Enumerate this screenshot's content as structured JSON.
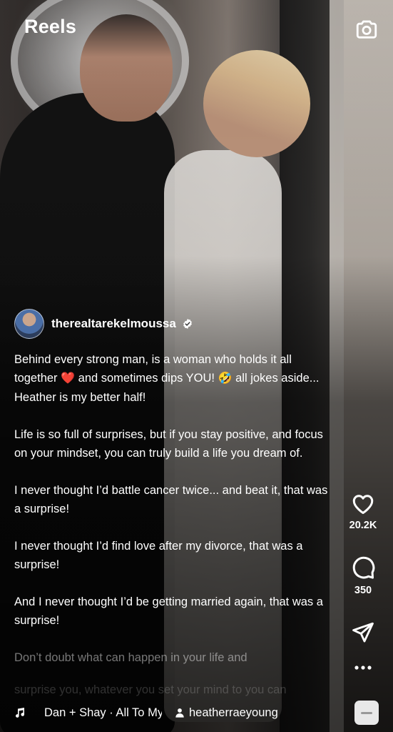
{
  "header": {
    "title": "Reels",
    "camera_icon": "camera-icon"
  },
  "post": {
    "username": "therealtarekelmoussa",
    "verified_icon": "verified-badge-icon",
    "caption": [
      {
        "before": "Behind every strong man, is a woman who holds it all together ",
        "emoji1": "❤️",
        "middle": " and sometimes dips YOU! ",
        "emoji2": "🤣",
        "after": "  all jokes aside... Heather is my better half!"
      },
      "Life is so full of surprises, but if you stay positive, and focus on your mindset, you can truly build a life you dream of.",
      "I never thought I’d battle cancer twice... and beat it, that was a surprise!",
      "I never thought I’d find love after my divorce, that was a surprise!",
      "And I never thought I’d be getting married again, that was a surprise!",
      "Don’t doubt what can happen in your life and",
      "surprise you, whatever you set your mind to you can"
    ]
  },
  "actions": {
    "like": {
      "icon": "heart-icon",
      "count": "20.2K"
    },
    "comment": {
      "icon": "comment-icon",
      "count": "350"
    },
    "share": {
      "icon": "send-icon"
    },
    "more": {
      "icon": "more-icon"
    }
  },
  "bottom_bar": {
    "music_icon": "music-note-icon",
    "song": "Dan + Shay · All To Myself",
    "collab_icon": "user-icon",
    "collaborator": "heatherraeyoung"
  }
}
